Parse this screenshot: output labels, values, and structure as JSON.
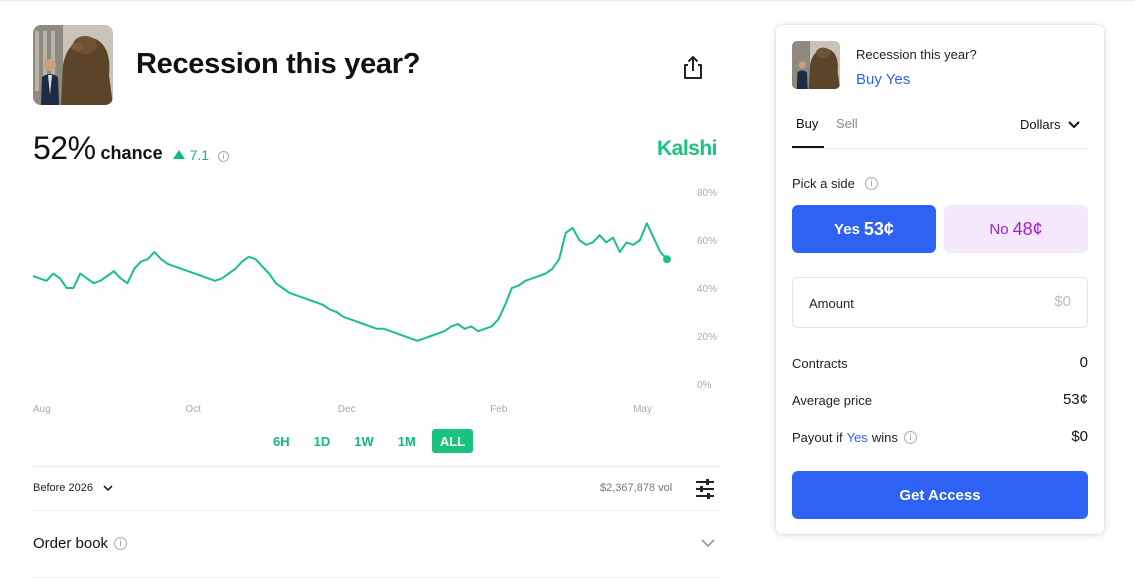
{
  "market": {
    "title": "Recession this year?",
    "chance_value": "52%",
    "chance_label": "chance",
    "delta": "7.1",
    "brand": "Kalshi"
  },
  "icons": {
    "thumb": "bear-statue-photo",
    "share": "share-icon",
    "info": "info-icon",
    "settings": "sliders-icon",
    "chevron": "chevron-down-icon",
    "delta": "triangle-up-icon"
  },
  "colors": {
    "accent_green": "#19c37d",
    "accent_blue": "#2d62f5",
    "no_purple": "#a11fd6",
    "no_bg": "#f6e8fc"
  },
  "chart_data": {
    "type": "line",
    "series": [
      {
        "values": [
          45,
          44,
          43,
          46,
          44,
          40,
          40,
          46,
          44,
          42,
          43,
          45,
          47,
          44,
          42,
          48,
          51,
          52,
          55,
          52,
          50,
          49,
          48,
          47,
          46,
          45,
          44,
          43,
          44,
          46,
          48,
          51,
          53,
          52,
          49,
          46,
          42,
          40,
          38,
          37,
          36,
          35,
          34,
          33,
          31,
          30,
          28,
          27,
          26,
          25,
          24,
          23,
          23,
          22,
          21,
          20,
          19,
          18,
          19,
          20,
          21,
          22,
          24,
          25,
          23,
          24,
          22,
          23,
          24,
          27,
          33,
          40,
          41,
          43,
          44,
          45,
          46,
          48,
          52,
          63,
          65,
          60,
          58,
          59,
          62,
          59,
          61,
          55,
          59,
          58,
          60,
          67,
          61,
          55,
          52
        ]
      }
    ],
    "x_tick_labels": [
      "Aug",
      "Oct",
      "Dec",
      "Feb",
      "May"
    ],
    "y_tick_labels": [
      "80%",
      "60%",
      "40%",
      "20%",
      "0%"
    ],
    "ylim": [
      0,
      80
    ],
    "grid": true,
    "current_value": 52
  },
  "ranges": [
    "6H",
    "1D",
    "1W",
    "1M",
    "ALL"
  ],
  "active_range": "ALL",
  "filter": {
    "label": "Before 2026",
    "volume": "$2,367,878 vol"
  },
  "orderbook": {
    "label": "Order book"
  },
  "panel": {
    "title": "Recession this year?",
    "action": "Buy Yes",
    "tab_buy": "Buy",
    "tab_sell": "Sell",
    "currency": "Dollars",
    "pick_label": "Pick a side",
    "yes_label": "Yes",
    "yes_price": "53¢",
    "no_label": "No",
    "no_price": "48¢",
    "amount_label": "Amount",
    "amount_placeholder": "$0",
    "contracts_label": "Contracts",
    "contracts_value": "0",
    "avg_label": "Average price",
    "avg_value": "53¢",
    "payout_prefix": "Payout if",
    "payout_side": "Yes",
    "payout_suffix": "wins",
    "payout_value": "$0",
    "cta": "Get Access"
  }
}
